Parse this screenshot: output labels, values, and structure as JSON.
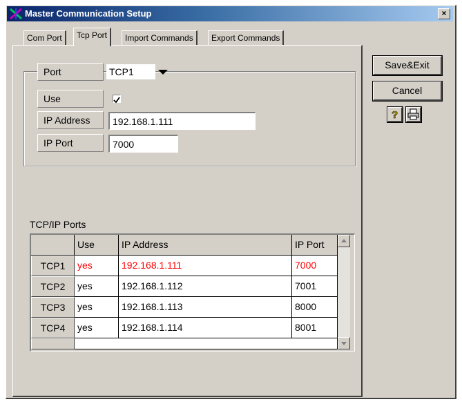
{
  "window": {
    "title": "Master Communication Setup",
    "close_label": "×"
  },
  "tabs": [
    {
      "label": "Com Port",
      "active": false
    },
    {
      "label": "Tcp Port",
      "active": true
    },
    {
      "label": "Import Commands",
      "active": false
    },
    {
      "label": "Export Commands",
      "active": false
    }
  ],
  "port_group": {
    "port_label": "Port",
    "port_value": "TCP1",
    "use_label": "Use",
    "use_checked": true,
    "ip_address_label": "IP Address",
    "ip_address_value": "192.168.1.111",
    "ip_port_label": "IP Port",
    "ip_port_value": "7000"
  },
  "ports_table": {
    "title": "TCP/IP Ports",
    "columns": [
      "Use",
      "IP Address",
      "IP Port"
    ],
    "rows": [
      {
        "name": "TCP1",
        "use": "yes",
        "ip": "192.168.1.111",
        "port": "7000",
        "highlight": true
      },
      {
        "name": "TCP2",
        "use": "yes",
        "ip": "192.168.1.112",
        "port": "7001",
        "highlight": false
      },
      {
        "name": "TCP3",
        "use": "yes",
        "ip": "192.168.1.113",
        "port": "8000",
        "highlight": false
      },
      {
        "name": "TCP4",
        "use": "yes",
        "ip": "192.168.1.114",
        "port": "8001",
        "highlight": false
      }
    ]
  },
  "buttons": {
    "save_exit": "Save&Exit",
    "cancel": "Cancel",
    "help_icon": "help-question-icon",
    "print_icon": "printer-icon"
  },
  "colors": {
    "title_start": "#0a246a",
    "title_end": "#a6caf0",
    "highlight_text": "#ff0000",
    "face": "#d4d0c8"
  }
}
